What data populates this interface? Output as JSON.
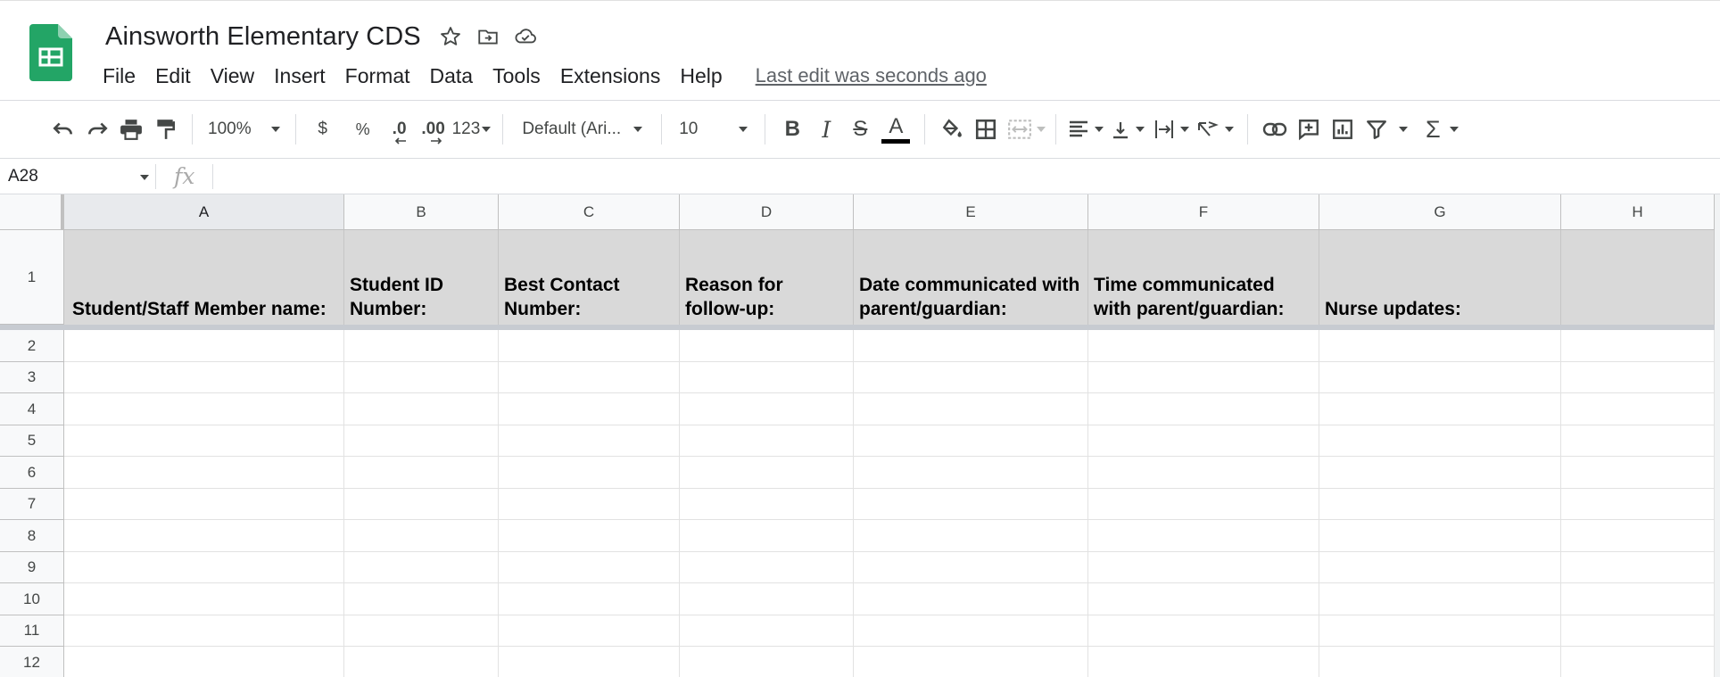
{
  "app": {
    "doc_title": "Ainsworth Elementary CDS",
    "last_edit": "Last edit was seconds ago",
    "brand_color": "#1e8e3e",
    "title_icons": [
      "star-icon",
      "move-to-folder-icon",
      "cloud-saved-icon"
    ]
  },
  "menu": [
    "File",
    "Edit",
    "View",
    "Insert",
    "Format",
    "Data",
    "Tools",
    "Extensions",
    "Help"
  ],
  "toolbar": {
    "zoom": "100%",
    "currency": "$",
    "percent": "%",
    "decrease_decimal": ".0",
    "increase_decimal": ".00",
    "more_formats": "123",
    "font": "Default (Ari...",
    "font_size": "10",
    "bold": "B",
    "italic": "I",
    "strikethrough": "S",
    "text_color": "A",
    "sum": "Σ"
  },
  "formula_bar": {
    "name_box": "A28",
    "fx": "fx",
    "value": ""
  },
  "sheet": {
    "columns": [
      "A",
      "B",
      "C",
      "D",
      "E",
      "F",
      "G",
      "H"
    ],
    "selected_column": "A",
    "header_row_number": "1",
    "header_cells": [
      "Student/Staff Member name:",
      "Student ID Number:",
      "Best Contact Number:",
      "Reason for follow-up:",
      "Date communicated with parent/guardian:",
      "Time communicated with parent/guardian:",
      "Nurse updates:",
      ""
    ],
    "header_fill": "#d9d9d9",
    "row_numbers": [
      "2",
      "3",
      "4",
      "5",
      "6",
      "7",
      "8",
      "9",
      "10",
      "11",
      "12"
    ]
  }
}
